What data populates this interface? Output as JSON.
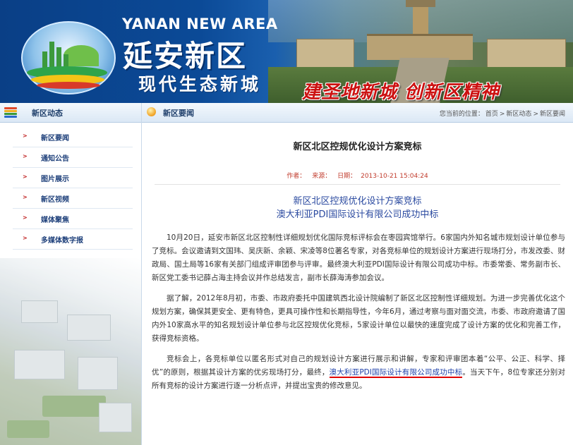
{
  "banner": {
    "english_name": "YANAN NEW AREA",
    "chinese_name": "延安新区",
    "subtitle": "现代生态新城",
    "slogan": "建圣地新城  创新区精神"
  },
  "sidebar": {
    "title": "新区动态",
    "items": [
      {
        "label": "新区要闻"
      },
      {
        "label": "通知公告"
      },
      {
        "label": "图片展示"
      },
      {
        "label": "新区视频"
      },
      {
        "label": "媒体聚焦"
      },
      {
        "label": "多媒体数字报"
      }
    ]
  },
  "section": {
    "title": "新区要闻",
    "breadcrumb": {
      "prefix": "您当前的位置：",
      "items": [
        "首页",
        "新区动态",
        "新区要闻"
      ],
      "separator": ">"
    }
  },
  "article": {
    "title": "新区北区控规优化设计方案竞标",
    "meta": {
      "author_label": "作者：",
      "source_label": "来源：",
      "date_label": "日期：",
      "date": "2013-10-21 15:04:24"
    },
    "subtitle_line1": "新区北区控规优化设计方案竞标",
    "subtitle_line2": "澳大利亚PDI国际设计有限公司成功中标",
    "para1": "10月20日，延安市新区北区控制性详细规划优化国际竞标评标会在枣园宾馆举行。6家国内外知名城市规划设计单位参与了竞标。会议邀请到文国玮、吴庆新、余颖、宋凌等8位著名专家，对各竞标单位的规划设计方案进行现场打分，市发改委、财政局、国土局等16家有关部门组成评审团参与评审。最终澳大利亚PDI国际设计有限公司成功中标。市委常委、常务副市长、新区党工委书记薛占海主持会议并作总结发言，副市长薛海涛参加会议。",
    "para2": "据了解，2012年8月初，市委、市政府委托中国建筑西北设计院编制了新区北区控制性详细规划。为进一步完善优化这个规划方案，确保其更安全、更有特色，更具可操作性和长期指导性，今年6月，通过考察与面对面交流，市委、市政府邀请了国内外10家高水平的知名规划设计单位参与北区控规优化竞标，5家设计单位以最快的速度完成了设计方案的优化和完善工作，获得竞标资格。",
    "para3_before": "竞标会上，各竞标单位以匿名形式对自己的规划设计方案进行展示和讲解，专家和评审团本着“公平、公正、科学、择优”的原则，根据其设计方案的优劣现场打分，最终，",
    "para3_highlight": "澳大利亚PDI国际设计有限公司成功中标",
    "para3_after": "。当天下午，8位专家还分别对所有竞标的设计方案进行逐一分析点评，并提出宝贵的修改意见。"
  },
  "colors": {
    "banner_blue": "#0b4a97",
    "slogan_red": "#cc1111",
    "link_blue": "#1d3f7a",
    "meta_red": "#c03a2b",
    "underline_red": "#e00000"
  }
}
